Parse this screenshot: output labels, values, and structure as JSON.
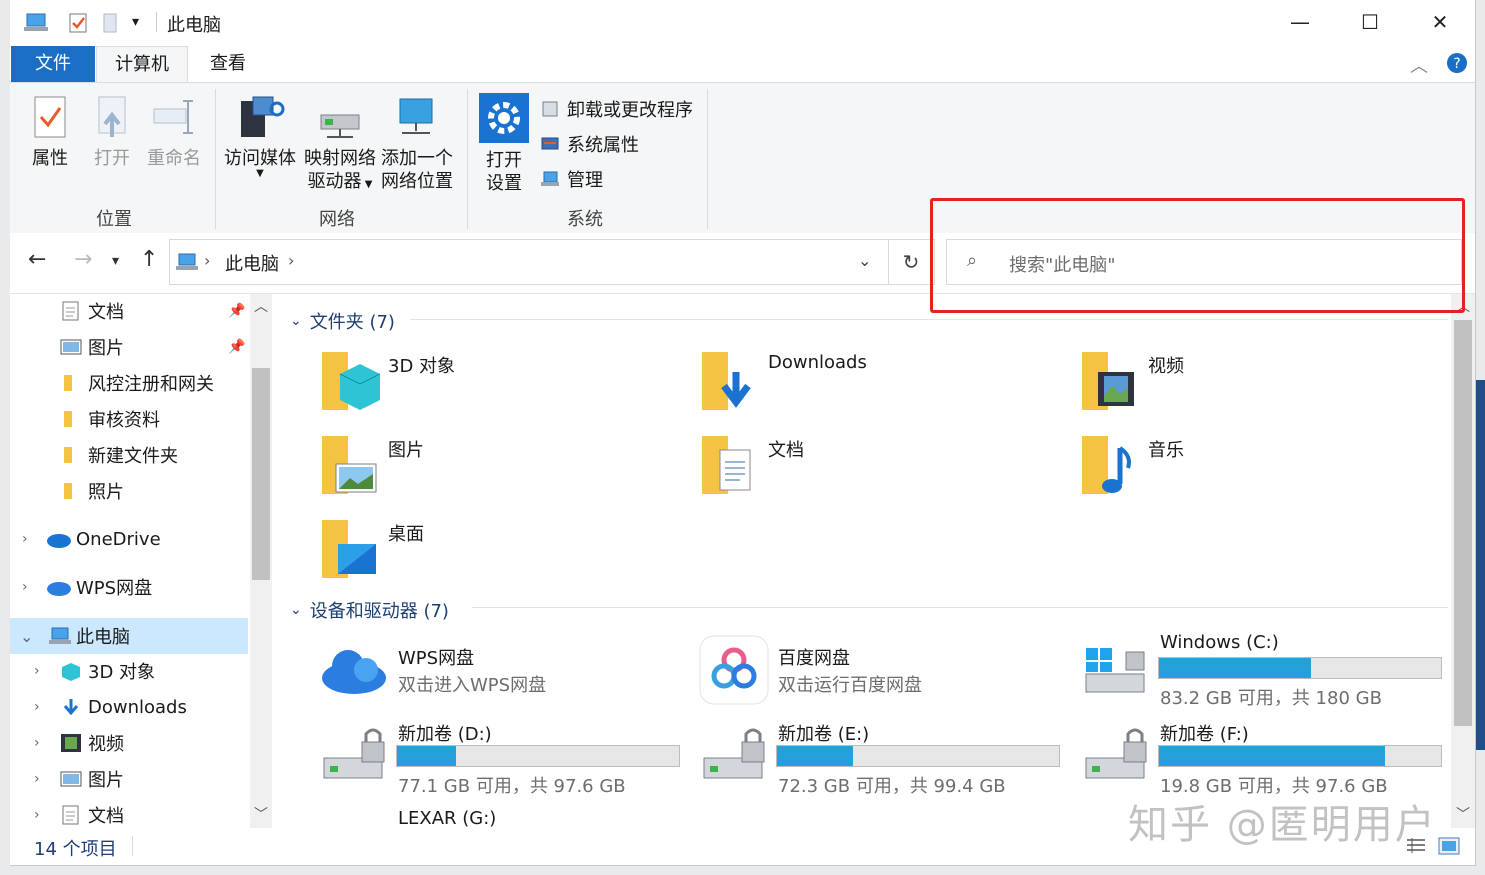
{
  "titlebar": {
    "title": "此电脑",
    "minimize": "—",
    "maximize": "☐",
    "close": "✕"
  },
  "ribbon_tabs": {
    "file": "文件",
    "computer": "计算机",
    "view": "查看"
  },
  "ribbon": {
    "location": {
      "label": "位置",
      "properties": "属性",
      "open": "打开",
      "rename": "重命名"
    },
    "network": {
      "label": "网络",
      "access_media": "访问媒体",
      "map_drive_1": "映射网络",
      "map_drive_2": "驱动器",
      "add_location_1": "添加一个",
      "add_location_2": "网络位置"
    },
    "system": {
      "label": "系统",
      "open_settings_1": "打开",
      "open_settings_2": "设置",
      "uninstall": "卸载或更改程序",
      "sys_props": "系统属性",
      "manage": "管理"
    }
  },
  "address": {
    "path": "此电脑",
    "search_placeholder": "搜索\"此电脑\""
  },
  "nav_pane": {
    "items": [
      {
        "label": "文档"
      },
      {
        "label": "图片"
      },
      {
        "label": "风控注册和网关"
      },
      {
        "label": "审核资料"
      },
      {
        "label": "新建文件夹"
      },
      {
        "label": "照片"
      },
      {
        "label": "OneDrive"
      },
      {
        "label": "WPS网盘"
      },
      {
        "label": "此电脑"
      },
      {
        "label": "3D 对象"
      },
      {
        "label": "Downloads"
      },
      {
        "label": "视频"
      },
      {
        "label": "图片"
      },
      {
        "label": "文档"
      }
    ]
  },
  "content": {
    "folders_header": "文件夹 (7)",
    "folders": [
      {
        "label": "3D 对象"
      },
      {
        "label": "Downloads"
      },
      {
        "label": "视频"
      },
      {
        "label": "图片"
      },
      {
        "label": "文档"
      },
      {
        "label": "音乐"
      },
      {
        "label": "桌面"
      }
    ],
    "devices_header": "设备和驱动器 (7)",
    "devices": [
      {
        "name": "WPS网盘",
        "sub": "双击进入WPS网盘"
      },
      {
        "name": "百度网盘",
        "sub": "双击运行百度网盘"
      },
      {
        "name": "Windows (C:)",
        "sub": "83.2 GB 可用，共 180 GB",
        "used_fraction": 0.54
      },
      {
        "name": "新加卷 (D:)",
        "sub": "77.1 GB 可用，共 97.6 GB",
        "used_fraction": 0.21
      },
      {
        "name": "新加卷 (E:)",
        "sub": "72.3 GB 可用，共 99.4 GB",
        "used_fraction": 0.27
      },
      {
        "name": "新加卷 (F:)",
        "sub": "19.8 GB 可用，共 97.6 GB",
        "used_fraction": 0.8
      },
      {
        "name": "LEXAR (G:)"
      }
    ]
  },
  "status": {
    "count": "14 个项目"
  },
  "watermark": "知乎 @匿明用户",
  "colors": {
    "accent": "#1a6fc4",
    "drive_bar": "#26a0da",
    "highlight_box": "#e3231c",
    "selected_row": "#cce8ff"
  }
}
